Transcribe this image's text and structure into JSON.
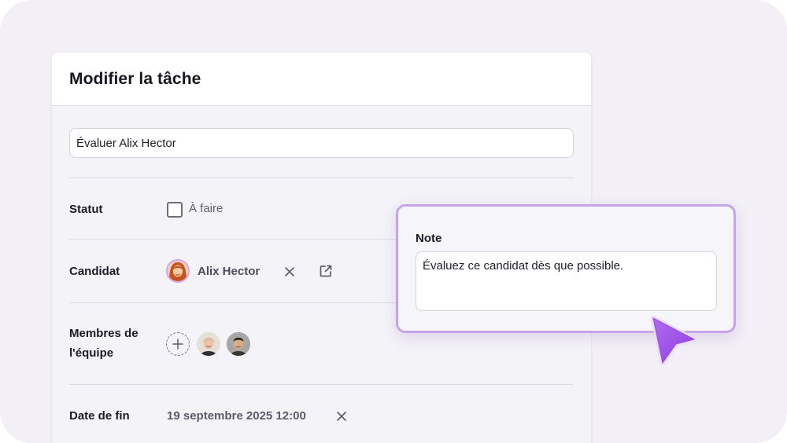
{
  "modal": {
    "title": "Modifier la tâche",
    "task_name_value": "Évaluer Alix Hector"
  },
  "fields": {
    "status": {
      "label": "Statut",
      "option": "À faire",
      "checked": false
    },
    "candidate": {
      "label": "Candidat",
      "name": "Alix Hector"
    },
    "team": {
      "label_line1": "Membres de",
      "label_line2": "l'équipe"
    },
    "due_date": {
      "label": "Date de fin",
      "value": "19 septembre 2025 12:00"
    }
  },
  "note": {
    "label": "Note",
    "value": "Évaluez ce candidat dès que possible."
  },
  "colors": {
    "accent": "#9b4de6",
    "note_border": "#c6a4e8",
    "background": "#f2f0f6"
  },
  "icons": [
    "checkbox-icon",
    "close-icon",
    "external-link-icon",
    "add-member-icon",
    "cursor-arrow-icon"
  ]
}
